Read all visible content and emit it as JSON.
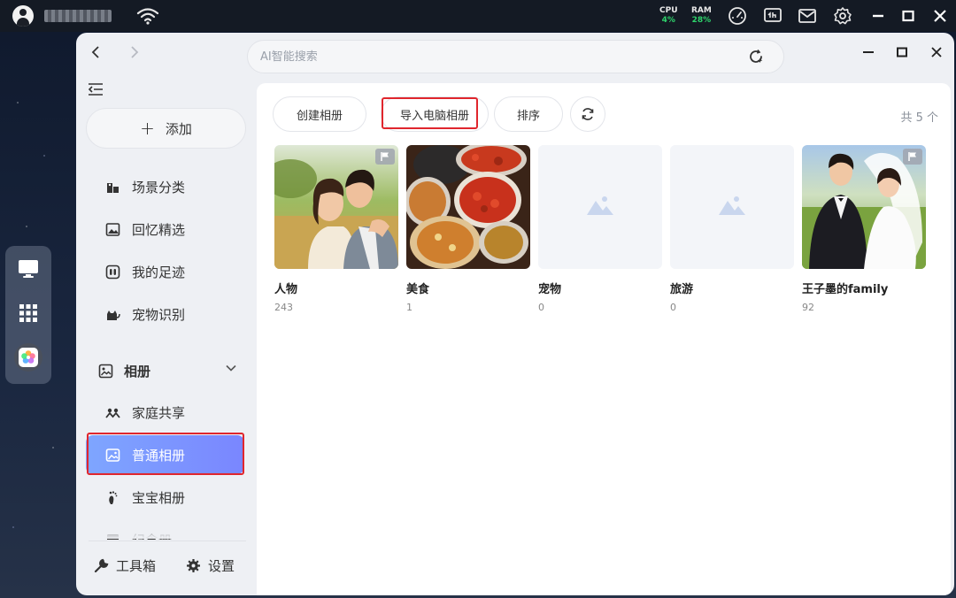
{
  "system": {
    "cpu_label": "CPU",
    "cpu_value": "4%",
    "ram_label": "RAM",
    "ram_value": "28%",
    "accent_green": "#2ed36b"
  },
  "search": {
    "placeholder": "AI智能搜索"
  },
  "sidebar": {
    "add_label": "添加",
    "items": [
      {
        "label": "场景分类",
        "icon": "scene-icon"
      },
      {
        "label": "回忆精选",
        "icon": "image-icon"
      },
      {
        "label": "我的足迹",
        "icon": "footprint-icon"
      },
      {
        "label": "宠物识别",
        "icon": "cat-icon"
      }
    ],
    "group": {
      "label": "相册",
      "icon": "album-icon"
    },
    "sub_items": [
      {
        "label": "家庭共享",
        "icon": "family-icon"
      },
      {
        "label": "普通相册",
        "icon": "photo-album-icon",
        "active": true
      },
      {
        "label": "宝宝相册",
        "icon": "baby-foot-icon"
      },
      {
        "label": "纪念册",
        "icon": "memorial-icon"
      }
    ],
    "toolbox_label": "工具箱",
    "settings_label": "设置",
    "active_color": "#7a96ff"
  },
  "toolbar": {
    "create_label": "创建相册",
    "import_label": "导入电脑相册",
    "sort_label": "排序",
    "count_label": "共 5 个"
  },
  "albums": [
    {
      "name": "人物",
      "count": "243"
    },
    {
      "name": "美食",
      "count": "1"
    },
    {
      "name": "宠物",
      "count": "0"
    },
    {
      "name": "旅游",
      "count": "0"
    },
    {
      "name": "王子墨的family",
      "count": "92"
    }
  ],
  "highlight_color": "#e0262d"
}
